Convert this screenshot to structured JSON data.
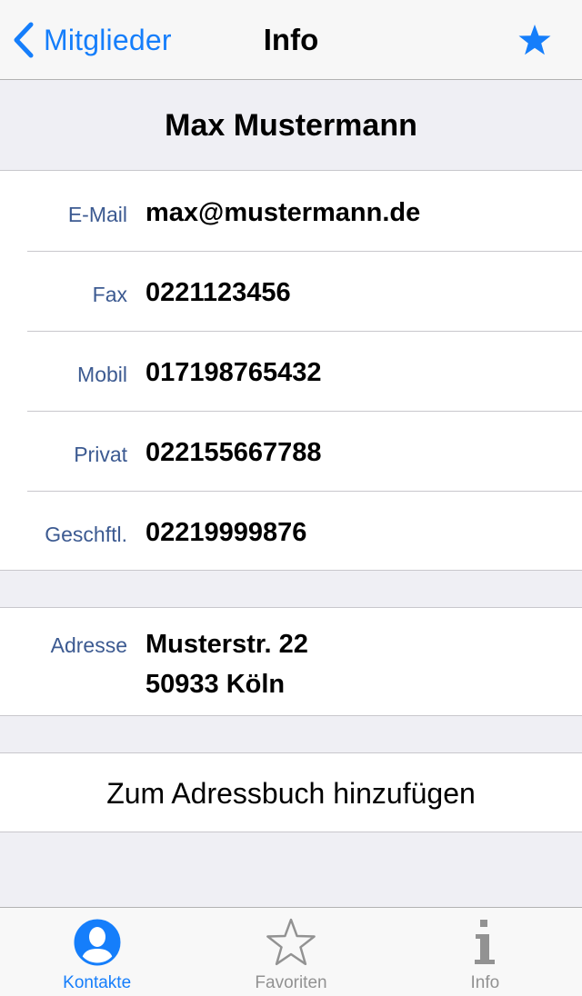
{
  "navbar": {
    "back_label": "Mitglieder",
    "title": "Info",
    "favorite_icon": "star-filled-icon"
  },
  "contact": {
    "name": "Max Mustermann",
    "fields": [
      {
        "label": "E-Mail",
        "value": "max@mustermann.de"
      },
      {
        "label": "Fax",
        "value": "0221123456"
      },
      {
        "label": "Mobil",
        "value": "017198765432"
      },
      {
        "label": "Privat",
        "value": "022155667788"
      },
      {
        "label": "Geschftl.",
        "value": "02219999876"
      }
    ],
    "address": {
      "label": "Adresse",
      "line1": "Musterstr. 22",
      "line2": "50933 Köln"
    }
  },
  "actions": {
    "add_to_addressbook": "Zum Adressbuch hinzufügen"
  },
  "tabbar": {
    "tabs": [
      {
        "label": "Kontakte",
        "icon": "contact-icon",
        "active": true
      },
      {
        "label": "Favoriten",
        "icon": "star-outline-icon",
        "active": false
      },
      {
        "label": "Info",
        "icon": "info-icon",
        "active": false
      }
    ]
  },
  "colors": {
    "accent": "#157efb",
    "label": "#3c5a91",
    "inactive": "#929292",
    "background": "#efeff4"
  }
}
